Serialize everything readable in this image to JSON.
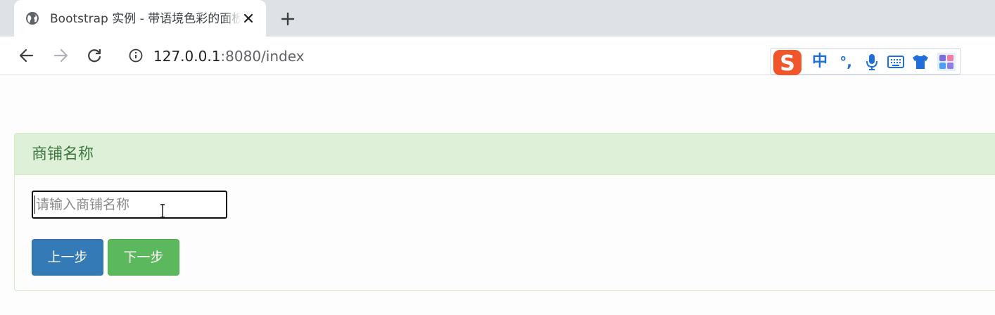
{
  "browser": {
    "tab_title": "Bootstrap 实例 - 带语境色彩的面板",
    "url_host": "127.0.0.1",
    "url_path": ":8080/index"
  },
  "ime": {
    "logo_letter": "S",
    "mode_label": "中",
    "punct_label": "°,",
    "icons": [
      "sogou-logo-icon",
      "chinese-mode",
      "punctuation-icon",
      "microphone-icon",
      "keyboard-icon",
      "skin-shirt-icon",
      "toolbox-icon"
    ]
  },
  "panel": {
    "title": "商铺名称",
    "input_placeholder": "请输入商铺名称",
    "prev_label": "上一步",
    "next_label": "下一步"
  },
  "colors": {
    "panel_heading_bg": "#dff0d8",
    "panel_title": "#3c763d",
    "primary": "#337ab7",
    "success": "#5cb85c"
  }
}
